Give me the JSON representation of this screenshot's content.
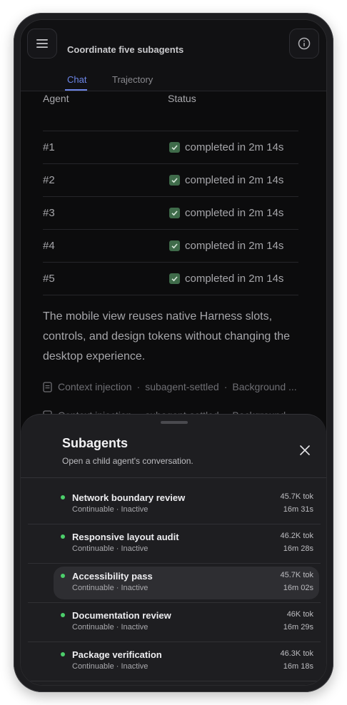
{
  "header": {
    "title": "Coordinate five subagents",
    "tabs": [
      {
        "label": "Chat",
        "active": true
      },
      {
        "label": "Trajectory",
        "active": false
      }
    ],
    "menu_icon": "hamburger-menu-icon",
    "info_icon": "info-icon"
  },
  "table": {
    "columns": [
      "Agent",
      "Status"
    ],
    "rows": [
      {
        "agent": "#1",
        "status": "completed in 2m 14s"
      },
      {
        "agent": "#2",
        "status": "completed in 2m 14s"
      },
      {
        "agent": "#3",
        "status": "completed in 2m 14s"
      },
      {
        "agent": "#4",
        "status": "completed in 2m 14s"
      },
      {
        "agent": "#5",
        "status": "completed in 2m 14s"
      }
    ]
  },
  "message": "The mobile view reuses native Harness slots, controls, and design tokens without changing the desktop experience.",
  "events": [
    {
      "label": "Context injection",
      "type": "subagent-settled",
      "detail": "Background ..."
    },
    {
      "label": "Context injection",
      "type": "subagent-settled",
      "detail": "Background ..."
    }
  ],
  "sheet": {
    "title": "Subagents",
    "subtitle": "Open a child agent's conversation.",
    "items": [
      {
        "name": "Network boundary review",
        "meta": "Continuable · Inactive",
        "tokens": "45.7K tok",
        "time": "16m 31s",
        "selected": false
      },
      {
        "name": "Responsive layout audit",
        "meta": "Continuable · Inactive",
        "tokens": "46.2K tok",
        "time": "16m 28s",
        "selected": false
      },
      {
        "name": "Accessibility pass",
        "meta": "Continuable · Inactive",
        "tokens": "45.7K tok",
        "time": "16m 02s",
        "selected": true
      },
      {
        "name": "Documentation review",
        "meta": "Continuable · Inactive",
        "tokens": "46K tok",
        "time": "16m 29s",
        "selected": false
      },
      {
        "name": "Package verification",
        "meta": "Continuable · Inactive",
        "tokens": "46.3K tok",
        "time": "16m 18s",
        "selected": false
      }
    ]
  },
  "colors": {
    "accent": "#6d86e8",
    "status_dot": "#4ccf6b",
    "check": "#3f6b4a",
    "background": "#0c0c0d",
    "sheet": "#1e1e21"
  }
}
